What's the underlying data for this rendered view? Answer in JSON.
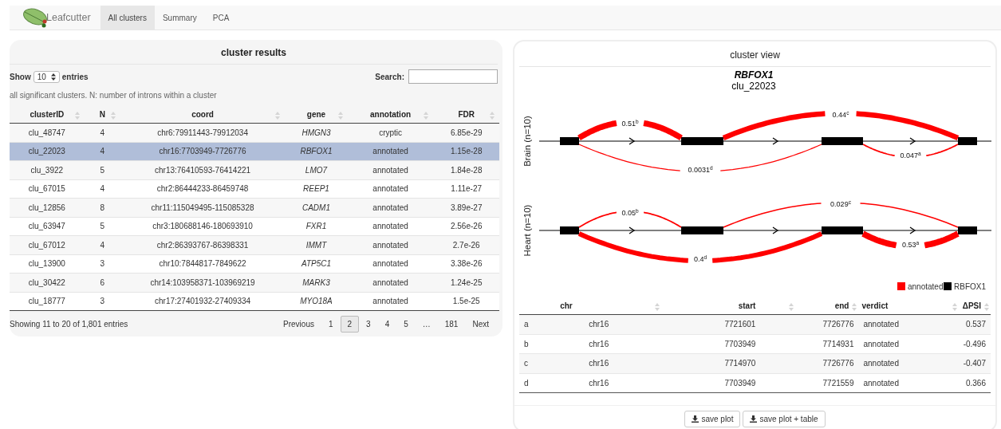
{
  "navbar": {
    "brand": "Leafcutter",
    "tabs": [
      {
        "label": "All clusters",
        "selected": true
      },
      {
        "label": "Summary",
        "selected": false
      },
      {
        "label": "PCA",
        "selected": false
      }
    ]
  },
  "results": {
    "title": "cluster results",
    "show_label": "Show",
    "page_size": "10",
    "entries_label": "entries",
    "search_label": "Search:",
    "caption": "all significant clusters. N: number of introns within a cluster",
    "columns": [
      "clusterID",
      "N",
      "coord",
      "gene",
      "annotation",
      "FDR"
    ],
    "rows": [
      {
        "cells": [
          "clu_48747",
          "4",
          "chr6:79911443-79912034",
          "HMGN3",
          "cryptic",
          "6.85e-29"
        ],
        "selected": false
      },
      {
        "cells": [
          "clu_22023",
          "4",
          "chr16:7703949-7726776",
          "RBFOX1",
          "annotated",
          "1.15e-28"
        ],
        "selected": true
      },
      {
        "cells": [
          "clu_3922",
          "5",
          "chr13:76410593-76414221",
          "LMO7",
          "annotated",
          "1.84e-28"
        ],
        "selected": false
      },
      {
        "cells": [
          "clu_67015",
          "4",
          "chr2:86444233-86459748",
          "REEP1",
          "annotated",
          "1.11e-27"
        ],
        "selected": false
      },
      {
        "cells": [
          "clu_12856",
          "8",
          "chr11:115049495-115085328",
          "CADM1",
          "annotated",
          "3.89e-27"
        ],
        "selected": false
      },
      {
        "cells": [
          "clu_63947",
          "5",
          "chr3:180688146-180693910",
          "FXR1",
          "annotated",
          "2.56e-26"
        ],
        "selected": false
      },
      {
        "cells": [
          "clu_67012",
          "4",
          "chr2:86393767-86398331",
          "IMMT",
          "annotated",
          "2.7e-26"
        ],
        "selected": false
      },
      {
        "cells": [
          "clu_13900",
          "3",
          "chr10:7844817-7849622",
          "ATP5C1",
          "annotated",
          "3.38e-26"
        ],
        "selected": false
      },
      {
        "cells": [
          "clu_30422",
          "6",
          "chr14:103958371-103969219",
          "MARK3",
          "annotated",
          "1.24e-25"
        ],
        "selected": false
      },
      {
        "cells": [
          "clu_18777",
          "3",
          "chr17:27401932-27409334",
          "MYO18A",
          "annotated",
          "1.5e-25"
        ],
        "selected": false
      }
    ],
    "info": "Showing 11 to 20 of 1,801 entries",
    "pages": [
      {
        "label": "Previous",
        "selected": false
      },
      {
        "label": "1",
        "selected": false
      },
      {
        "label": "2",
        "selected": true
      },
      {
        "label": "3",
        "selected": false
      },
      {
        "label": "4",
        "selected": false
      },
      {
        "label": "5",
        "selected": false
      },
      {
        "label": "…",
        "selected": false
      },
      {
        "label": "181",
        "selected": false
      },
      {
        "label": "Next",
        "selected": false
      }
    ]
  },
  "view": {
    "title": "cluster view",
    "gene": "RBFOX1",
    "cluster": "clu_22023",
    "tracks": [
      {
        "label": "Brain (n=10)",
        "junctions": [
          {
            "value": "0.51",
            "letter": "b"
          },
          {
            "value": "0.44",
            "letter": "c"
          },
          {
            "value": "0.0031",
            "letter": "d"
          },
          {
            "value": "0.047",
            "letter": "a"
          }
        ]
      },
      {
        "label": "Heart (n=10)",
        "junctions": [
          {
            "value": "0.05",
            "letter": "b"
          },
          {
            "value": "0.029",
            "letter": "c"
          },
          {
            "value": "0.4",
            "letter": "d"
          },
          {
            "value": "0.53",
            "letter": "a"
          }
        ]
      }
    ],
    "legend": [
      {
        "label": "annotated",
        "color": "#ff0000"
      },
      {
        "label": "RBFOX1",
        "color": "#000000"
      }
    ],
    "columns": [
      "",
      "chr",
      "start",
      "end",
      "verdict",
      "ΔPSI"
    ],
    "rows": [
      [
        "a",
        "chr16",
        "7721601",
        "7726776",
        "annotated",
        "0.537"
      ],
      [
        "b",
        "chr16",
        "7703949",
        "7714931",
        "annotated",
        "-0.496"
      ],
      [
        "c",
        "chr16",
        "7714970",
        "7726776",
        "annotated",
        "-0.407"
      ],
      [
        "d",
        "chr16",
        "7703949",
        "7721559",
        "annotated",
        "0.366"
      ]
    ],
    "buttons": [
      "save plot",
      "save plot + table"
    ]
  }
}
